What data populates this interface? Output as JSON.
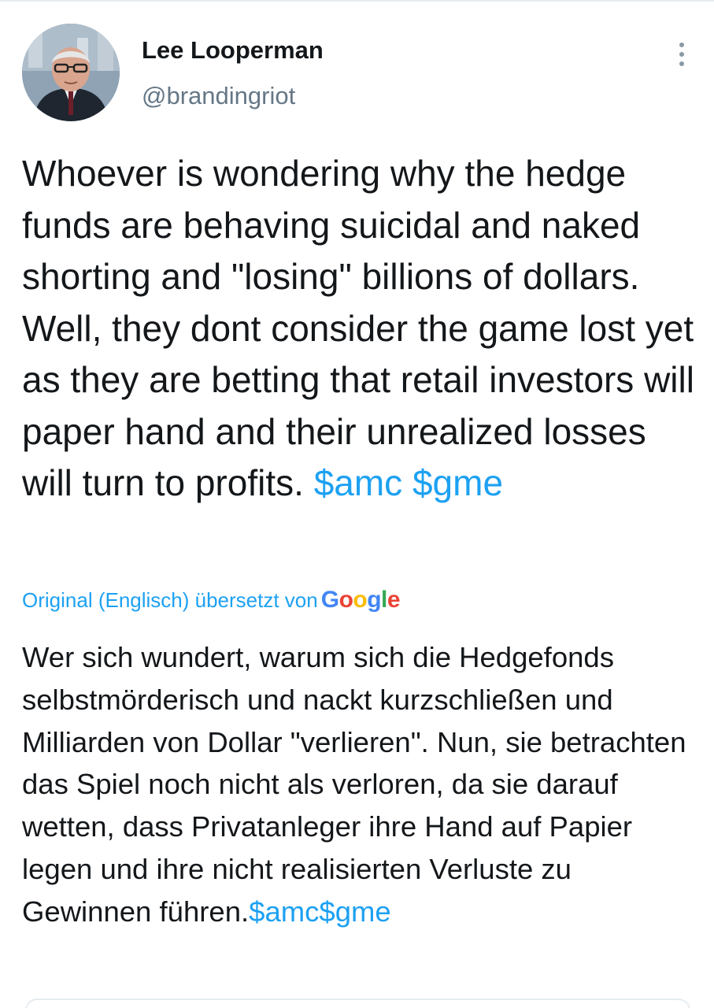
{
  "author": {
    "display_name": "Lee Looperman",
    "handle": "@brandingriot"
  },
  "tweet": {
    "text": "Whoever is wondering why the hedge funds are behaving suicidal and naked shorting and \"losing\" billions of dollars. Well, they dont consider the game lost yet as they are betting that retail investors will paper hand and their unrealized losses will turn to profits.",
    "hashtags": [
      "$amc",
      "$gme"
    ]
  },
  "translation": {
    "note": "Original (Englisch) übersetzt von",
    "provider": "Google",
    "text": "Wer sich wundert, warum sich die Hedgefonds selbstmörderisch und nackt kurzschließen und Milliarden von Dollar \"verlieren\". Nun, sie betrachten das Spiel noch nicht als verloren, da sie darauf wetten, dass Privatanleger ihre Hand auf Papier legen und ihre nicht realisierten Verluste zu Gewinnen führen.",
    "hashtags_joined": "$amc$gme"
  },
  "icons": {
    "more": "more-vertical-icon",
    "avatar": "avatar"
  },
  "colors": {
    "link": "#1da1f2",
    "text": "#14171a",
    "secondary": "#657786"
  }
}
